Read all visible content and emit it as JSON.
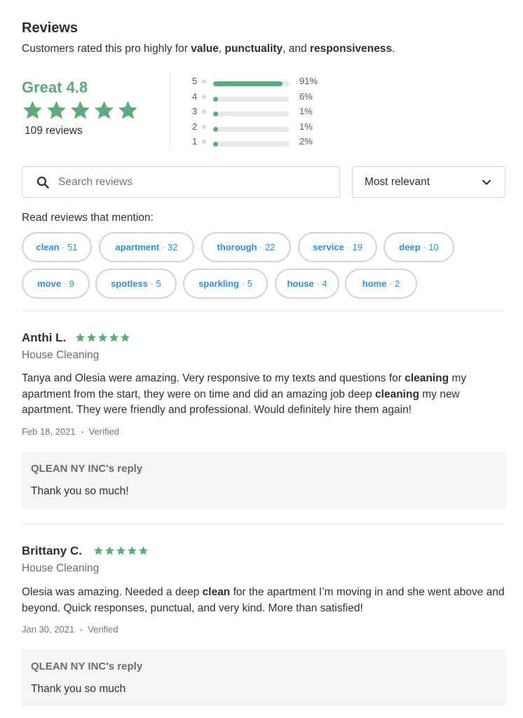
{
  "header": {
    "title": "Reviews",
    "subtitle_prefix": "Customers rated this pro highly for ",
    "kw1": "value",
    "sep1": ", ",
    "kw2": "punctuality",
    "sep2": ", and ",
    "kw3": "responsiveness",
    "suffix": "."
  },
  "summary": {
    "score_text": "Great 4.8",
    "rating": 4.8,
    "review_count": "109 reviews",
    "distribution": [
      {
        "stars": "5",
        "fraction": 0.91,
        "percent": "91%"
      },
      {
        "stars": "4",
        "fraction": 0.06,
        "percent": "6%"
      },
      {
        "stars": "3",
        "fraction": 0.01,
        "percent": "1%"
      },
      {
        "stars": "2",
        "fraction": 0.01,
        "percent": "1%"
      },
      {
        "stars": "1",
        "fraction": 0.02,
        "percent": "2%"
      }
    ]
  },
  "search": {
    "placeholder": "Search reviews",
    "icon": "search-icon"
  },
  "sort": {
    "selected": "Most relevant",
    "icon": "chevron-down-icon"
  },
  "mentions": {
    "label": "Read reviews that mention:",
    "chips": [
      {
        "keyword": "clean",
        "count": "51"
      },
      {
        "keyword": "apartment",
        "count": "32"
      },
      {
        "keyword": "thorough",
        "count": "22"
      },
      {
        "keyword": "service",
        "count": "19"
      },
      {
        "keyword": "deep",
        "count": "10"
      },
      {
        "keyword": "move",
        "count": "9"
      },
      {
        "keyword": "spotless",
        "count": "5"
      },
      {
        "keyword": "sparkling",
        "count": "5"
      },
      {
        "keyword": "house",
        "count": "4"
      },
      {
        "keyword": "home",
        "count": "2"
      }
    ],
    "separator": "·"
  },
  "reviews": [
    {
      "name": "Anthi L.",
      "rating": 5,
      "category": "House Cleaning",
      "segments": [
        {
          "text": "Tanya and Olesia were amazing. Very responsive to my texts and questions for ",
          "bold": false
        },
        {
          "text": "cleaning",
          "bold": true
        },
        {
          "text": " my apartment from the start, they were on time and did an amazing job deep ",
          "bold": false
        },
        {
          "text": "cleaning",
          "bold": true
        },
        {
          "text": " my new apartment. They were friendly and professional. Would definitely hire them again!",
          "bold": false
        }
      ],
      "date": "Feb 18, 2021",
      "status": "Verified",
      "reply_title": "QLEAN NY INC's reply",
      "reply_text": "Thank you so much!"
    },
    {
      "name": "Brittany C.",
      "rating": 5,
      "category": "House Cleaning",
      "segments": [
        {
          "text": "Olesia was amazing. Needed a deep ",
          "bold": false
        },
        {
          "text": "clean",
          "bold": true
        },
        {
          "text": " for the apartment I’m moving in and she went above and beyond. Quick responses, punctual, and very kind. More than satisfied!",
          "bold": false
        }
      ],
      "date": "Jan 30, 2021",
      "status": "Verified",
      "reply_title": "QLEAN NY INC's reply",
      "reply_text": "Thank you so much"
    }
  ],
  "colors": {
    "accent_green": "#5dab79",
    "link_blue": "#2f8fd6",
    "star_gray": "#cfd0d2"
  }
}
